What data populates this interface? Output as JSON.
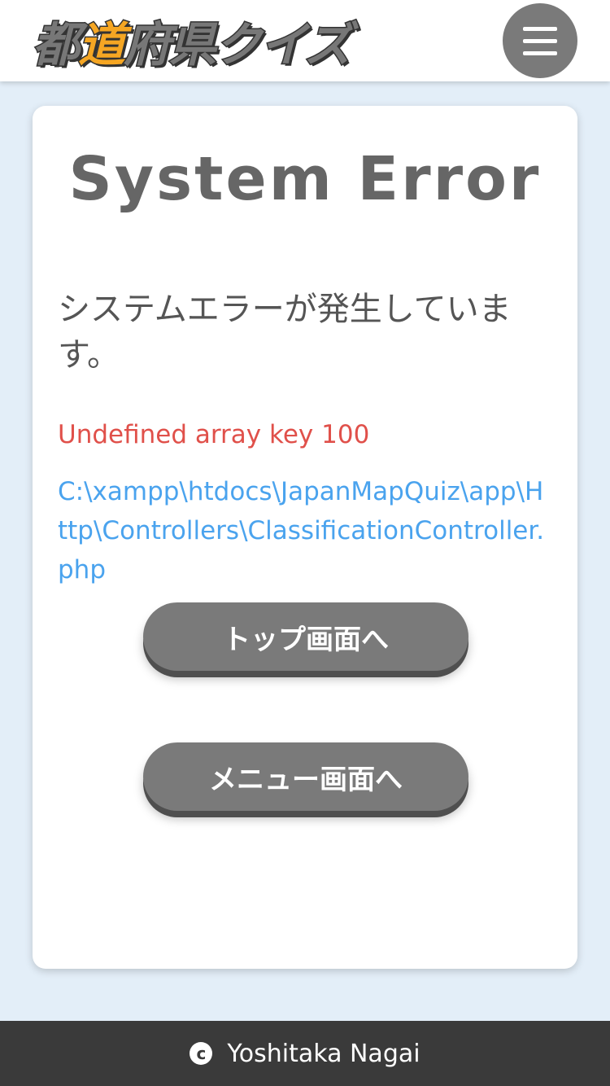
{
  "header": {
    "logo_part1": "都",
    "logo_accent": "道",
    "logo_part2": "府県クイズ",
    "menu_icon": "hamburger-menu-icon",
    "accent_color": "#f5a623"
  },
  "card": {
    "title": "System Error",
    "message": "システムエラーが発生しています。",
    "error_message": "Undefined array key 100",
    "error_path": "C:\\xampp\\htdocs\\JapanMapQuiz\\app\\Http\\Controllers\\ClassificationController.php"
  },
  "buttons": {
    "top_label": "トップ画面へ",
    "menu_label": "メニュー画面へ"
  },
  "footer": {
    "copyright_icon": "copyright-icon",
    "copyright_symbol": "c",
    "author": "Yoshitaka Nagai"
  },
  "colors": {
    "background": "#e3eef8",
    "error_red": "#e0504a",
    "path_blue": "#4aa3ee",
    "button_gray": "#7a7a7a",
    "footer_dark": "#3a3a3a"
  }
}
